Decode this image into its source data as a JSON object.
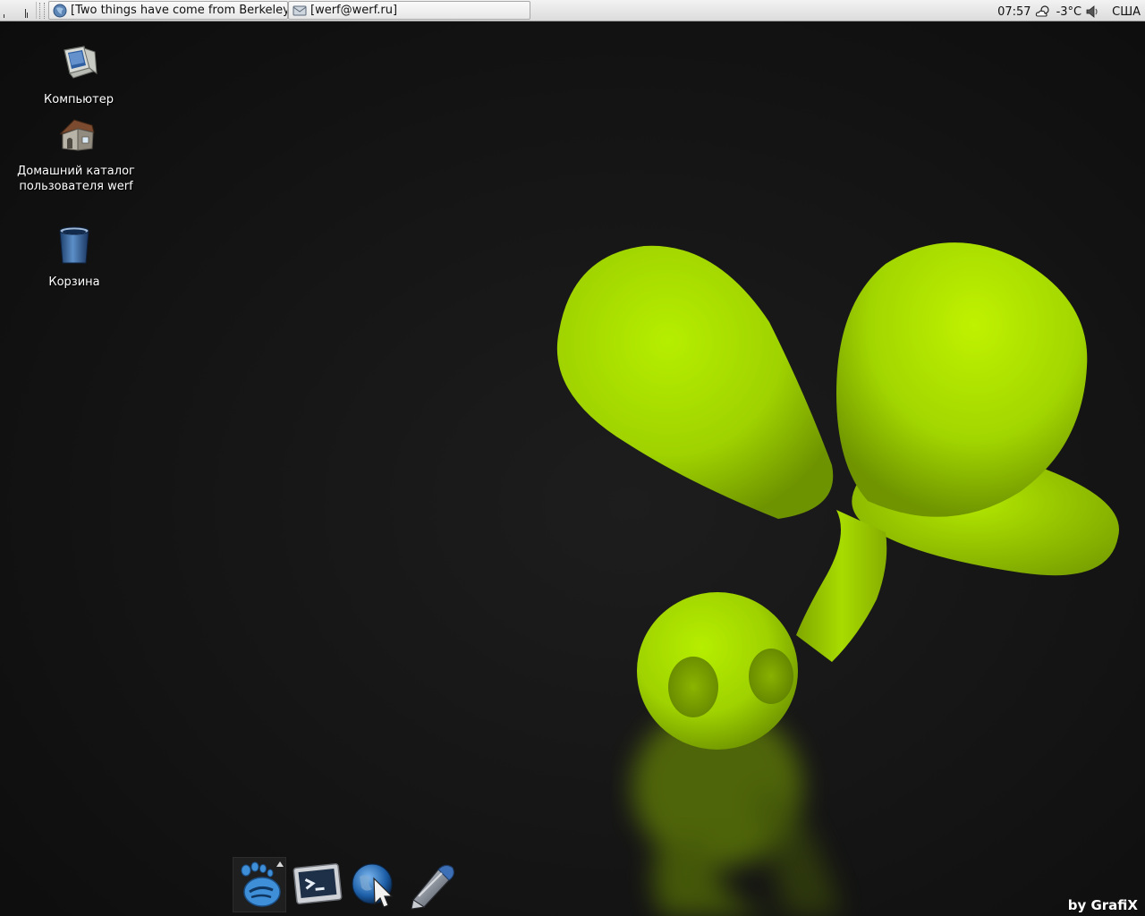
{
  "panel": {
    "tasks": [
      {
        "label": "[Two things have come from Berkeley"
      },
      {
        "label": "[werf@werf.ru]"
      }
    ],
    "clock": "07:57",
    "weather_temp": "-3°C",
    "keyboard_layout": "США",
    "icons": {
      "menu": "signal-bars-icon",
      "weather": "cloud-sun-icon",
      "volume": "speaker-icon"
    }
  },
  "desktop": {
    "icons": [
      {
        "label": "Компьютер",
        "icon": "computer-icon"
      },
      {
        "label_line1": "Домашний каталог",
        "label_line2": "пользователя werf",
        "icon": "home-folder-icon"
      },
      {
        "label": "Корзина",
        "icon": "trash-icon"
      }
    ]
  },
  "wallpaper": {
    "signature": "by GrafiX",
    "accent": "#a6dc00"
  },
  "dock": {
    "items": [
      {
        "icon": "gnome-foot-icon"
      },
      {
        "icon": "terminal-icon"
      },
      {
        "icon": "web-browser-icon"
      },
      {
        "icon": "pen-editor-icon"
      }
    ]
  }
}
